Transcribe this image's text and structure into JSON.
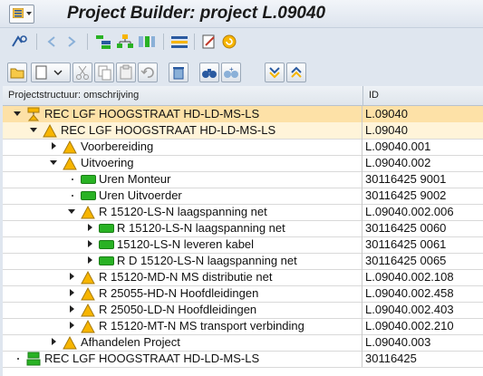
{
  "title": "Project Builder: project L.09040",
  "header": {
    "col1": "Projectstructuur: omschrijving",
    "col2": "ID"
  },
  "rows": [
    {
      "level": 0,
      "exp": "down",
      "icon": "project",
      "text": "REC LGF HOOGSTRAAT HD-LD-MS-LS",
      "id": "L.09040",
      "bg": "sel"
    },
    {
      "level": 1,
      "exp": "down",
      "icon": "wbs",
      "text": "REC LGF HOOGSTRAAT HD-LD-MS-LS",
      "id": "L.09040",
      "bg": "alt"
    },
    {
      "level": 2,
      "exp": "right",
      "icon": "wbs",
      "text": "Voorbereiding",
      "id": "L.09040.001",
      "bg": ""
    },
    {
      "level": 2,
      "exp": "down",
      "icon": "wbs",
      "text": "Uitvoering",
      "id": "L.09040.002",
      "bg": ""
    },
    {
      "level": 3,
      "exp": "dot",
      "icon": "activity",
      "text": "Uren Monteur",
      "id": "30116425 9001",
      "bg": ""
    },
    {
      "level": 3,
      "exp": "dot",
      "icon": "activity",
      "text": "Uren Uitvoerder",
      "id": "30116425 9002",
      "bg": ""
    },
    {
      "level": 3,
      "exp": "down",
      "icon": "wbs",
      "text": "R 15120-LS-N  laagspanning net",
      "id": "L.09040.002.006",
      "bg": ""
    },
    {
      "level": 4,
      "exp": "right",
      "icon": "activity",
      "text": "R 15120-LS-N  laagspanning net",
      "id": "30116425 0060",
      "bg": ""
    },
    {
      "level": 4,
      "exp": "right",
      "icon": "activity",
      "text": "15120-LS-N  leveren kabel",
      "id": "30116425 0061",
      "bg": ""
    },
    {
      "level": 4,
      "exp": "right",
      "icon": "activity",
      "text": "R D 15120-LS-N  laagspanning net",
      "id": "30116425 0065",
      "bg": ""
    },
    {
      "level": 3,
      "exp": "right",
      "icon": "wbs",
      "text": "R 15120-MD-N  MS distributie net",
      "id": "L.09040.002.108",
      "bg": ""
    },
    {
      "level": 3,
      "exp": "right",
      "icon": "wbs",
      "text": "R 25055-HD-N Hoofdleidingen",
      "id": "L.09040.002.458",
      "bg": ""
    },
    {
      "level": 3,
      "exp": "right",
      "icon": "wbs",
      "text": "R 25050-LD-N Hoofdleidingen",
      "id": "L.09040.002.403",
      "bg": ""
    },
    {
      "level": 3,
      "exp": "right",
      "icon": "wbs",
      "text": "R 15120-MT-N  MS transport verbinding",
      "id": "L.09040.002.210",
      "bg": ""
    },
    {
      "level": 2,
      "exp": "right",
      "icon": "wbs",
      "text": "Afhandelen Project",
      "id": "L.09040.003",
      "bg": ""
    },
    {
      "level": 0,
      "exp": "dot",
      "icon": "network",
      "text": "REC LGF HOOGSTRAAT HD-LD-MS-LS",
      "id": "30116425",
      "bg": ""
    }
  ],
  "colors": {
    "selected_row": "#fde1a7",
    "alt_row": "#fff4d9",
    "wbs_icon": "#f7b500",
    "activity_icon": "#29b224"
  }
}
